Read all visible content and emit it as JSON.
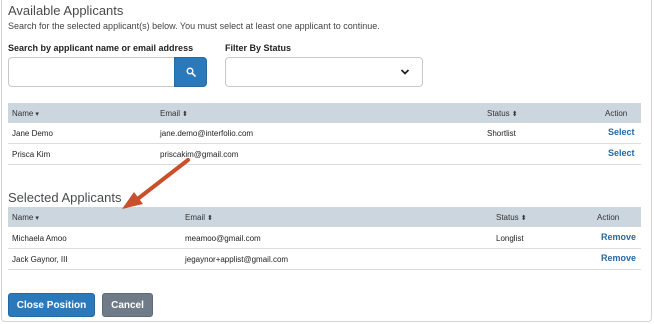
{
  "available": {
    "title": "Available Applicants",
    "instructions": "Search for the selected applicant(s) below. You must select at least one applicant to continue.",
    "search_label": "Search by applicant name or email address",
    "search_value": "",
    "filter_label": "Filter By Status",
    "filter_value": "",
    "columns": {
      "name": "Name",
      "email": "Email",
      "status": "Status",
      "action": "Action"
    },
    "rows": [
      {
        "name": "Jane Demo",
        "email": "jane.demo@interfolio.com",
        "status": "Shortlist",
        "action": "Select"
      },
      {
        "name": "Prisca Kim",
        "email": "priscakim@gmail.com",
        "status": "",
        "action": "Select"
      }
    ]
  },
  "selected": {
    "title": "Selected Applicants",
    "columns": {
      "name": "Name",
      "email": "Email",
      "status": "Status",
      "action": "Action"
    },
    "rows": [
      {
        "name": "Michaela Amoo",
        "email": "meamoo@gmail.com",
        "status": "Longlist",
        "action": "Remove"
      },
      {
        "name": "Jack Gaynor, III",
        "email": "jegaynor+applist@gmail.com",
        "status": "",
        "action": "Remove"
      }
    ]
  },
  "buttons": {
    "close": "Close Position",
    "cancel": "Cancel"
  },
  "colors": {
    "primary": "#2b79ba",
    "secondary": "#6f7b89",
    "table_header": "#ccd6df",
    "arrow": "#c8502a"
  }
}
